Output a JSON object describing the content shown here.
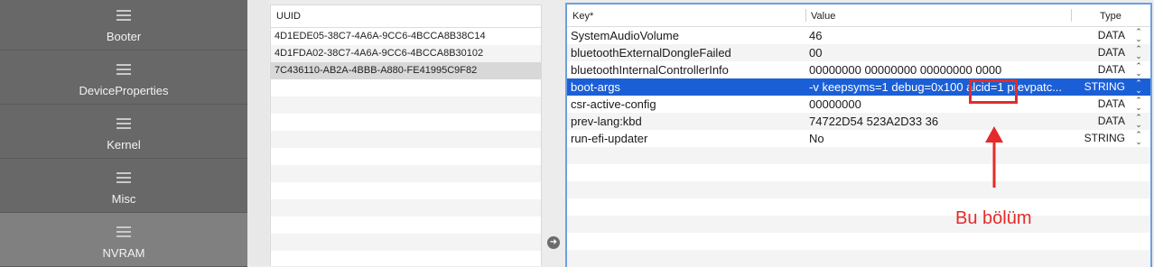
{
  "sidebar": {
    "items": [
      {
        "label": "Booter",
        "icon": "list-icon"
      },
      {
        "label": "DeviceProperties",
        "icon": "list-icon"
      },
      {
        "label": "Kernel",
        "icon": "list-icon"
      },
      {
        "label": "Misc",
        "icon": "list-icon"
      },
      {
        "label": "NVRAM",
        "icon": "list-icon"
      }
    ],
    "active": "NVRAM"
  },
  "uuid_panel": {
    "header": "UUID",
    "rows": [
      "4D1EDE05-38C7-4A6A-9CC6-4BCCA8B38C14",
      "4D1FDA02-38C7-4A6A-9CC6-4BCCA8B30102",
      "7C436110-AB2A-4BBB-A880-FE41995C9F82"
    ],
    "selected_index": 2
  },
  "key_table": {
    "headers": {
      "key": "Key*",
      "value": "Value",
      "type": "Type"
    },
    "rows": [
      {
        "key": "SystemAudioVolume",
        "value": "46",
        "type": "DATA"
      },
      {
        "key": "bluetoothExternalDongleFailed",
        "value": "00",
        "type": "DATA"
      },
      {
        "key": "bluetoothInternalControllerInfo",
        "value": "00000000 00000000 00000000 0000",
        "type": "DATA"
      },
      {
        "key": "boot-args",
        "value": "-v keepsyms=1 debug=0x100 alcid=1 prevpatc...",
        "type": "STRING"
      },
      {
        "key": "csr-active-config",
        "value": "00000000",
        "type": "DATA"
      },
      {
        "key": "prev-lang:kbd",
        "value": "74722D54 523A2D33 36",
        "type": "DATA"
      },
      {
        "key": "run-efi-updater",
        "value": "No",
        "type": "STRING"
      }
    ],
    "selected_index": 3,
    "stepper_glyph": "⌃⌄"
  },
  "annotation": {
    "text": "Bu bölüm",
    "color": "#e32b2b"
  },
  "colors": {
    "selection": "#1b5fd6",
    "focus_border": "#6b9fe3",
    "sidebar": "#686868"
  }
}
